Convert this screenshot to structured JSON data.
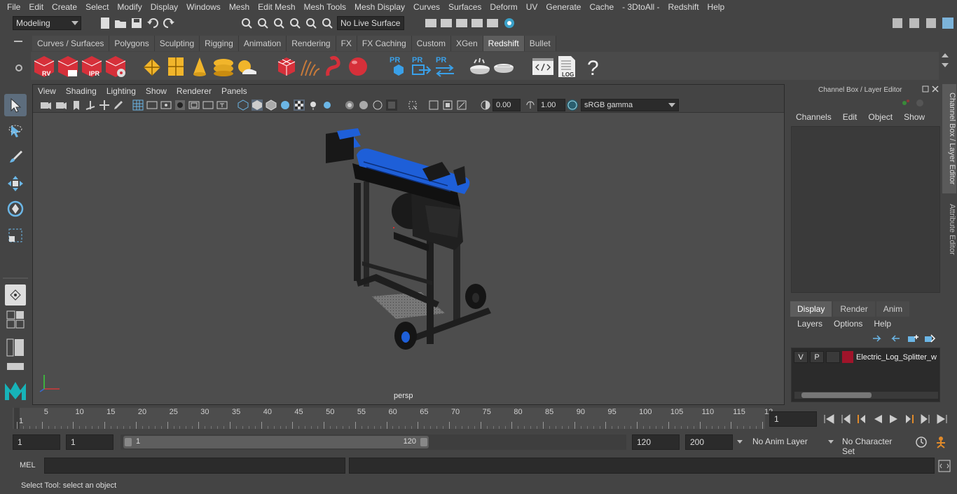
{
  "menubar": [
    "File",
    "Edit",
    "Create",
    "Select",
    "Modify",
    "Display",
    "Windows",
    "Mesh",
    "Edit Mesh",
    "Mesh Tools",
    "Mesh Display",
    "Curves",
    "Surfaces",
    "Deform",
    "UV",
    "Generate",
    "Cache",
    "- 3DtoAll -",
    "Redshift",
    "Help"
  ],
  "statusline": {
    "workspace": "Modeling",
    "live_surface": "No Live Surface"
  },
  "shelf": {
    "tabs": [
      "Curves / Surfaces",
      "Polygons",
      "Sculpting",
      "Rigging",
      "Animation",
      "Rendering",
      "FX",
      "FX Caching",
      "Custom",
      "XGen",
      "Redshift",
      "Bullet"
    ],
    "active_tab": "Redshift",
    "icon_labels": {
      "rv": "RV",
      "ipr": "IPR",
      "pr": "PR",
      "log": "LOG",
      "help": "?"
    }
  },
  "panel": {
    "menu": [
      "View",
      "Shading",
      "Lighting",
      "Show",
      "Renderer",
      "Panels"
    ],
    "exposure": "0.00",
    "gamma": "1.00",
    "color_space": "sRGB gamma",
    "camera_label": "persp"
  },
  "right_panel": {
    "title": "Channel Box / Layer Editor",
    "channel_menu": [
      "Channels",
      "Edit",
      "Object",
      "Show"
    ],
    "layer_tabs": [
      "Display",
      "Render",
      "Anim"
    ],
    "active_layer_tab": "Display",
    "layer_menu": [
      "Layers",
      "Options",
      "Help"
    ],
    "layer": {
      "v": "V",
      "p": "P",
      "name": "Electric_Log_Splitter_w",
      "color": "#a0142a"
    }
  },
  "side_tabs": [
    "Channel Box / Layer Editor",
    "Attribute Editor"
  ],
  "timeline": {
    "ticks": [
      "1",
      "5",
      "10",
      "15",
      "20",
      "25",
      "30",
      "35",
      "40",
      "45",
      "50",
      "55",
      "60",
      "65",
      "70",
      "75",
      "80",
      "85",
      "90",
      "95",
      "100",
      "105",
      "110",
      "115",
      "12"
    ],
    "current_frame": "1"
  },
  "range": {
    "start_field": "1",
    "start_field2": "1",
    "range_start": "1",
    "range_end": "120",
    "end_field": "120",
    "end_field2": "200",
    "anim_layer": "No Anim Layer",
    "character_set": "No Character Set"
  },
  "cmd": {
    "label": "MEL"
  },
  "help_line": "Select Tool: select an object",
  "colors": {
    "accent_blue": "#1e5fd8",
    "layer_red": "#a0142a",
    "redshift_red": "#d6303a"
  }
}
